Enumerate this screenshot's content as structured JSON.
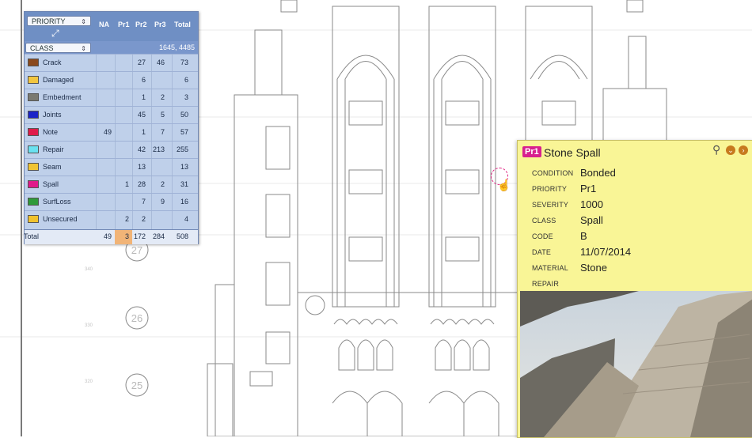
{
  "summary_table": {
    "priority_select": "PRIORITY",
    "class_select": "CLASS",
    "columns": [
      "NA",
      "Pr1",
      "Pr2",
      "Pr3",
      "Total"
    ],
    "grand_total": "1645, 4485",
    "rows": [
      {
        "label": "Crack",
        "color": "#8b4a1e",
        "na": "",
        "pr1": "",
        "pr2": "27",
        "pr3": "46",
        "total": "73"
      },
      {
        "label": "Damaged",
        "color": "#f2c640",
        "na": "",
        "pr1": "",
        "pr2": "6",
        "pr3": "",
        "total": "6"
      },
      {
        "label": "Embedment",
        "color": "#7a7a72",
        "na": "",
        "pr1": "",
        "pr2": "1",
        "pr3": "2",
        "total": "3"
      },
      {
        "label": "Joints",
        "color": "#1b24c8",
        "na": "",
        "pr1": "",
        "pr2": "45",
        "pr3": "5",
        "total": "50"
      },
      {
        "label": "Note",
        "color": "#e01b4a",
        "na": "49",
        "pr1": "",
        "pr2": "1",
        "pr3": "7",
        "total": "57"
      },
      {
        "label": "Repair",
        "color": "#6ae1f0",
        "na": "",
        "pr1": "",
        "pr2": "42",
        "pr3": "213",
        "total": "255"
      },
      {
        "label": "Seam",
        "color": "#f0c434",
        "na": "",
        "pr1": "",
        "pr2": "13",
        "pr3": "",
        "total": "13"
      },
      {
        "label": "Spall",
        "color": "#e01a8a",
        "na": "",
        "pr1": "1",
        "pr2": "28",
        "pr3": "2",
        "total": "31"
      },
      {
        "label": "SurfLoss",
        "color": "#2f9a3a",
        "na": "",
        "pr1": "",
        "pr2": "7",
        "pr3": "9",
        "total": "16"
      },
      {
        "label": "Unsecured",
        "color": "#f0c22e",
        "na": "",
        "pr1": "2",
        "pr2": "2",
        "pr3": "",
        "total": "4"
      }
    ],
    "totals": {
      "label": "Total",
      "na": "49",
      "pr1": "3",
      "pr2": "172",
      "pr3": "284",
      "total": "508"
    }
  },
  "drawing": {
    "bay_numbers": [
      "27",
      "26",
      "25"
    ],
    "level_marks": [
      "340",
      "330",
      "320"
    ]
  },
  "info_popup": {
    "badge": "Pr1",
    "title": "Stone Spall",
    "fields": [
      {
        "label": "CONDITION",
        "value": "Bonded"
      },
      {
        "label": "PRIORITY",
        "value": "Pr1"
      },
      {
        "label": "SEVERITY",
        "value": "1000"
      },
      {
        "label": "CLASS",
        "value": "Spall"
      },
      {
        "label": "CODE",
        "value": "B"
      },
      {
        "label": "DATE",
        "value": "11/07/2014"
      },
      {
        "label": "MATERIAL",
        "value": "Stone"
      },
      {
        "label": "REPAIR",
        "value": ""
      }
    ]
  }
}
